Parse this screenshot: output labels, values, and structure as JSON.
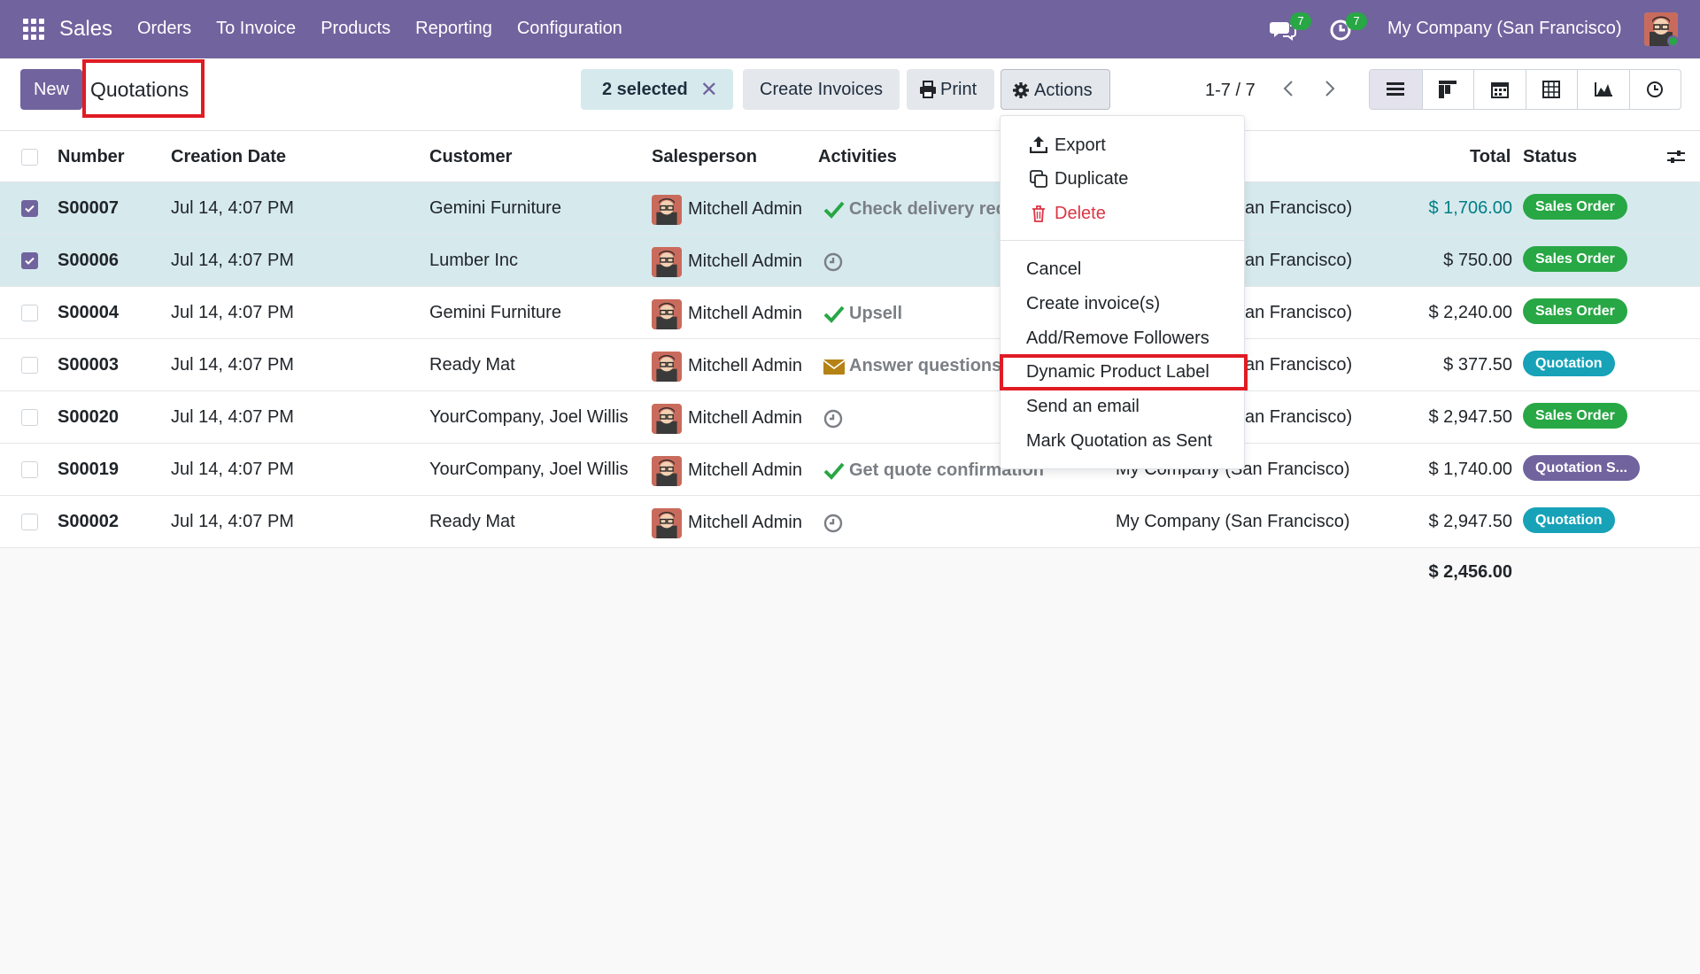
{
  "topbar": {
    "brand": "Sales",
    "menu": [
      "Orders",
      "To Invoice",
      "Products",
      "Reporting",
      "Configuration"
    ],
    "messages_badge": "7",
    "activities_badge": "7",
    "company": "My Company (San Francisco)"
  },
  "control": {
    "new_label": "New",
    "title": "Quotations",
    "selected_label": "2 selected",
    "create_invoices_label": "Create Invoices",
    "print_label": "Print",
    "actions_label": "Actions",
    "pager": "1-7 / 7"
  },
  "columns": {
    "number": "Number",
    "date": "Creation Date",
    "customer": "Customer",
    "salesperson": "Salesperson",
    "activities": "Activities",
    "total": "Total",
    "status": "Status"
  },
  "rows": [
    {
      "number": "S00007",
      "date": "Jul 14, 4:07 PM",
      "customer": "Gemini Furniture",
      "salesperson": "Mitchell Admin",
      "activity": "Check delivery req",
      "activity_icon": "check-icon",
      "company": "an Francisco)",
      "total": "$ 1,706.00",
      "status": "Sales Order",
      "selected": true
    },
    {
      "number": "S00006",
      "date": "Jul 14, 4:07 PM",
      "customer": "Lumber Inc",
      "salesperson": "Mitchell Admin",
      "activity": "",
      "activity_icon": "clock-icon",
      "company": "an Francisco)",
      "total": "$ 750.00",
      "status": "Sales Order",
      "selected": true
    },
    {
      "number": "S00004",
      "date": "Jul 14, 4:07 PM",
      "customer": "Gemini Furniture",
      "salesperson": "Mitchell Admin",
      "activity": "Upsell",
      "activity_icon": "check-icon",
      "company": "an Francisco)",
      "total": "$ 2,240.00",
      "status": "Sales Order",
      "selected": false
    },
    {
      "number": "S00003",
      "date": "Jul 14, 4:07 PM",
      "customer": "Ready Mat",
      "salesperson": "Mitchell Admin",
      "activity": "Answer questions",
      "activity_icon": "envelope-icon",
      "company": "an Francisco)",
      "total": "$ 377.50",
      "status": "Quotation",
      "selected": false
    },
    {
      "number": "S00020",
      "date": "Jul 14, 4:07 PM",
      "customer": "YourCompany, Joel Willis",
      "salesperson": "Mitchell Admin",
      "activity": "",
      "activity_icon": "clock-icon",
      "company": "an Francisco)",
      "total": "$ 2,947.50",
      "status": "Sales Order",
      "selected": false
    },
    {
      "number": "S00019",
      "date": "Jul 14, 4:07 PM",
      "customer": "YourCompany, Joel Willis",
      "salesperson": "Mitchell Admin",
      "activity": "Get quote confirmation",
      "activity_icon": "check-icon",
      "company": "My Company (San Francisco)",
      "total": "$ 1,740.00",
      "status": "Quotation S...",
      "selected": false
    },
    {
      "number": "S00002",
      "date": "Jul 14, 4:07 PM",
      "customer": "Ready Mat",
      "salesperson": "Mitchell Admin",
      "activity": "",
      "activity_icon": "clock-icon",
      "company": "My Company (San Francisco)",
      "total": "$ 2,947.50",
      "status": "Quotation",
      "selected": false
    }
  ],
  "footer_total": "$ 2,456.00",
  "status_colors": {
    "Sales Order": "#28a745",
    "Quotation": "#17a2b8",
    "Quotation S...": "#71639e"
  },
  "dropdown": {
    "export": "Export",
    "duplicate": "Duplicate",
    "delete": "Delete",
    "items": [
      "Cancel",
      "Create invoice(s)",
      "Add/Remove Followers",
      "Dynamic Product Label",
      "Send an email",
      "Mark Quotation as Sent"
    ]
  },
  "colors": {
    "brand": "#71639e",
    "highlight": "#e01b24",
    "selected_row": "#d6eaee"
  }
}
